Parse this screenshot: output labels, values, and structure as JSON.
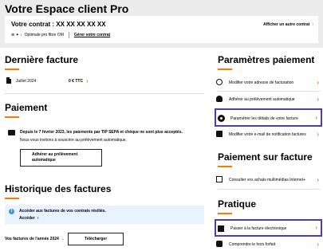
{
  "header": {
    "title": "Votre Espace client Pro",
    "contract_title": "Votre contrat : XX XX XX XX XX",
    "offer": "Optimale pro fibre OM",
    "manage_link": "Gérer votre contrat",
    "other_contract": "Afficher un autre contrat"
  },
  "last_invoice": {
    "title": "Dernière facture",
    "date": "Juillet 2024",
    "amount": "0 € TTC"
  },
  "payment": {
    "title": "Paiement",
    "notice_bold": "Depuis le 7 février 2023, les paiements par TIP SEPA et chèque ne sont plus acceptés.",
    "notice_text": "Nous vous invitons à souscrire au prélèvement automatique.",
    "button": "Adhérer au prélèvement automatique"
  },
  "history": {
    "title": "Historique des factures",
    "info_bold": "Accéder aux factures de vos contrats résiliés.",
    "info_link": "Accéder",
    "year_label": "Vos factures de l'année 2024",
    "download": "Télécharger"
  },
  "settings": {
    "title": "Paramètres paiement",
    "items": [
      {
        "label": "Modifier votre adresse de facturation"
      },
      {
        "label": "Adhérer au prélèvement automatique"
      },
      {
        "label": "Paramétrer les détails de votre facture"
      },
      {
        "label": "Modifier votre e-mail de notification factures"
      }
    ]
  },
  "invoice_payment": {
    "title": "Paiement sur facture",
    "items": [
      {
        "label": "Consulter vos achats multimédias Internet+"
      }
    ]
  },
  "practical": {
    "title": "Pratique",
    "items": [
      {
        "label": "Passer à la facture électronique"
      },
      {
        "label": "Comprendre le hors forfait"
      }
    ]
  },
  "colors": {
    "accent": "#ff7900",
    "highlight": "#4b3db5",
    "info_bg": "#e8f3ff"
  }
}
